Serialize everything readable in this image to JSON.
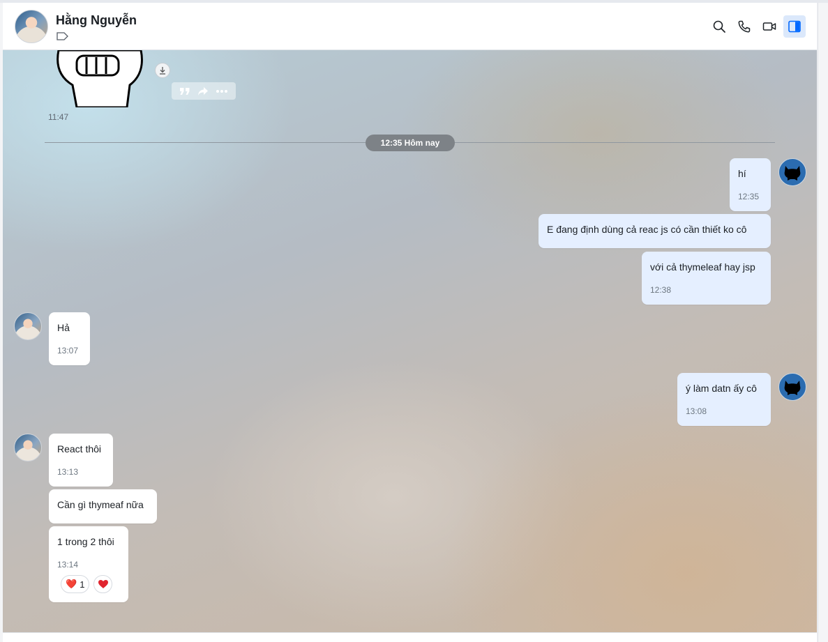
{
  "header": {
    "contact_name": "Hằng Nguyễn"
  },
  "icons": {
    "search": "search-icon",
    "call": "phone-icon",
    "video": "video-icon",
    "panel": "panel-toggle-icon",
    "tag": "tag-icon"
  },
  "colors": {
    "bubble_me": "#e5efff",
    "bubble_them": "#ffffff",
    "accent": "#0068ff",
    "date_pill": "#7d8287"
  },
  "chat": {
    "sticker_time": "11:47",
    "date_divider": "12:35 Hôm nay",
    "messages": [
      {
        "sender": "me",
        "text": "hí",
        "time": "12:35"
      },
      {
        "sender": "me",
        "text": "E đang định dùng cả reac js có cần thiết ko cô",
        "time": ""
      },
      {
        "sender": "me",
        "text": "với cả thymeleaf hay jsp",
        "time": "12:38"
      },
      {
        "sender": "them",
        "text": "Hả",
        "time": "13:07"
      },
      {
        "sender": "me",
        "text": "ý làm datn ấy cô",
        "time": "13:08"
      },
      {
        "sender": "them",
        "text": "React thôi",
        "time": "13:13"
      },
      {
        "sender": "them",
        "text": "Cần gì thymeaf nữa",
        "time": ""
      },
      {
        "sender": "them",
        "text": "1 trong 2 thôi",
        "time": "13:14",
        "reaction": {
          "emoji": "❤️",
          "count": "1"
        }
      }
    ]
  }
}
